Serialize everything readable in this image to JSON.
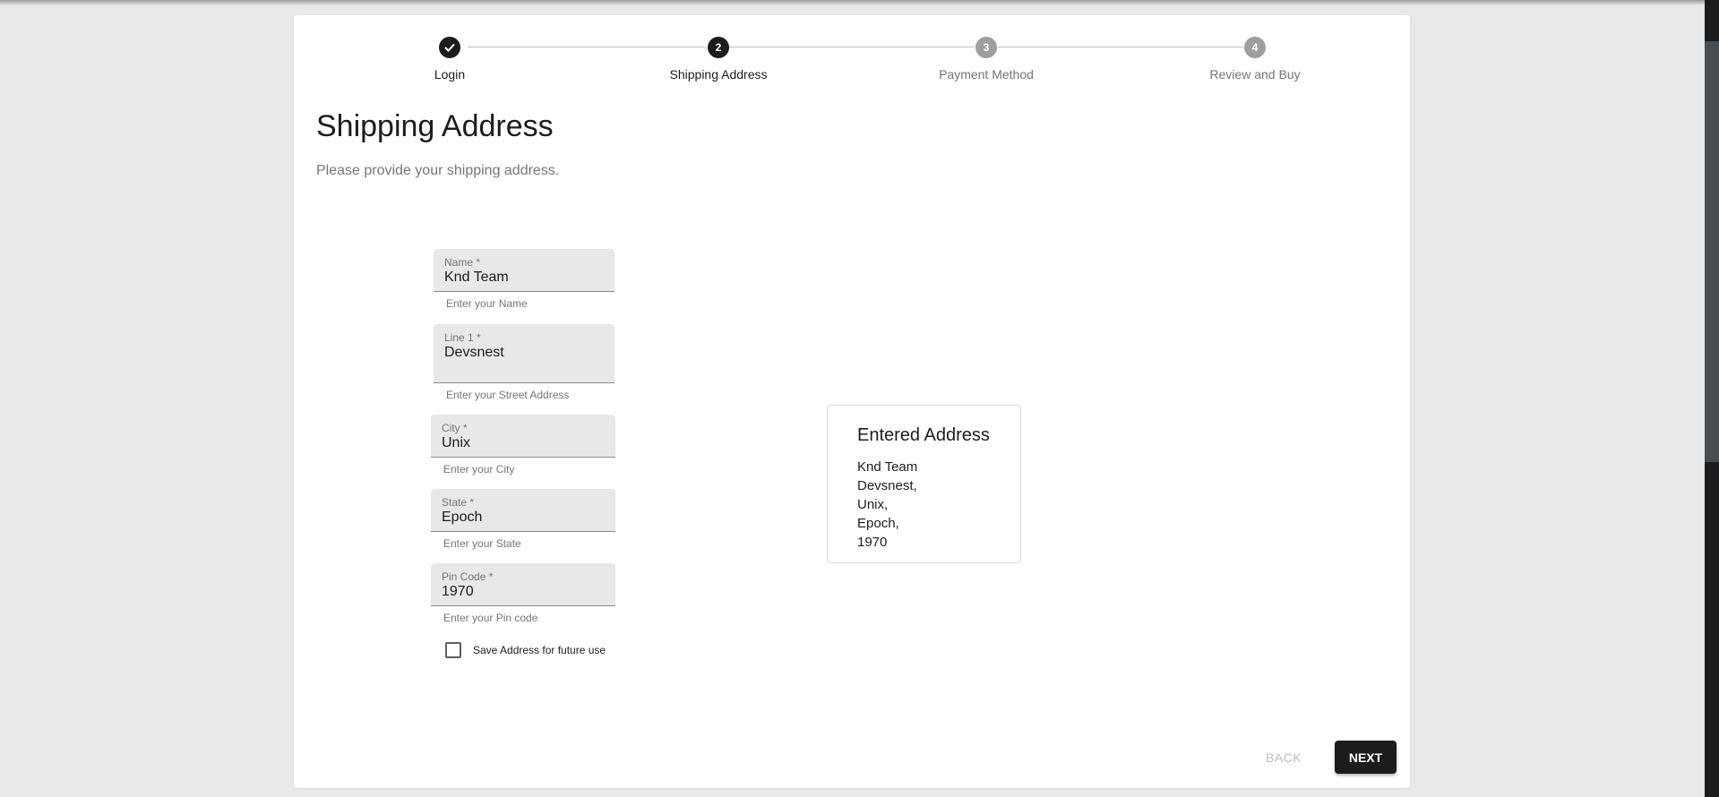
{
  "stepper": {
    "steps": [
      {
        "label": "Login",
        "icon": "check-icon",
        "number": "",
        "state": "completed"
      },
      {
        "label": "Shipping Address",
        "icon": "",
        "number": "2",
        "state": "active"
      },
      {
        "label": "Payment Method",
        "icon": "",
        "number": "3",
        "state": "inactive"
      },
      {
        "label": "Review and Buy",
        "icon": "",
        "number": "4",
        "state": "inactive"
      }
    ],
    "check_glyph": "✓"
  },
  "header": {
    "title": "Shipping Address",
    "subtitle": "Please provide your shipping address."
  },
  "form": {
    "fields": [
      {
        "label": "Name *",
        "value": "Knd Team",
        "helper": "Enter your Name"
      },
      {
        "label": "Line 1 *",
        "value": "Devsnest",
        "helper": "Enter your Street Address"
      },
      {
        "label": "City *",
        "value": "Unix",
        "helper": "Enter your City"
      },
      {
        "label": "State *",
        "value": "Epoch",
        "helper": "Enter your State"
      },
      {
        "label": "Pin Code *",
        "value": "1970",
        "helper": "Enter your Pin code"
      }
    ],
    "save_checkbox": {
      "label": "Save Address for future use",
      "checked": false
    }
  },
  "address_preview": {
    "title": "Entered Address",
    "lines": [
      "Knd Team",
      "Devsnest,",
      "Unix,",
      "Epoch,",
      "1970"
    ]
  },
  "actions": {
    "back_label": "BACK",
    "next_label": "NEXT"
  }
}
